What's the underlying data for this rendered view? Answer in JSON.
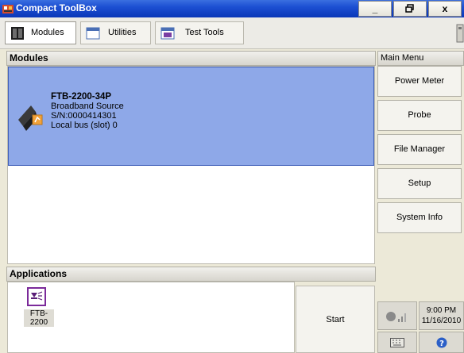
{
  "window": {
    "title": "Compact ToolBox",
    "minimize": "_",
    "maximize": "ə",
    "close": "x"
  },
  "toolbar": {
    "tabs": [
      {
        "label": "Modules",
        "icon": "modules-icon",
        "active": true
      },
      {
        "label": "Utilities",
        "icon": "utilities-icon",
        "active": false
      },
      {
        "label": "Test Tools",
        "icon": "test-tools-icon",
        "active": false
      }
    ]
  },
  "modules": {
    "header": "Modules",
    "items": [
      {
        "name": "FTB-2200-34P",
        "description": "Broadband Source",
        "serial": "S/N:0000414301",
        "location": "Local bus (slot) 0",
        "icon": "broadband-source-module-icon"
      }
    ]
  },
  "applications": {
    "header": "Applications",
    "items": [
      {
        "label": "FTB-2200",
        "icon": "ftb-2200-app-icon"
      }
    ],
    "start_label": "Start"
  },
  "main_menu": {
    "header": "Main Menu",
    "items": [
      "Power Meter",
      "Probe",
      "File Manager",
      "Setup",
      "System Info"
    ]
  },
  "status": {
    "time": "9:00 PM",
    "date": "11/16/2010",
    "signal_icon": "signal-strength-icon",
    "keyboard_icon": "keyboard-icon",
    "help_icon": "help-icon"
  },
  "colors": {
    "titlebar": "#1c4fd2",
    "selection": "#8ea8e8",
    "background": "#ece9d8"
  }
}
